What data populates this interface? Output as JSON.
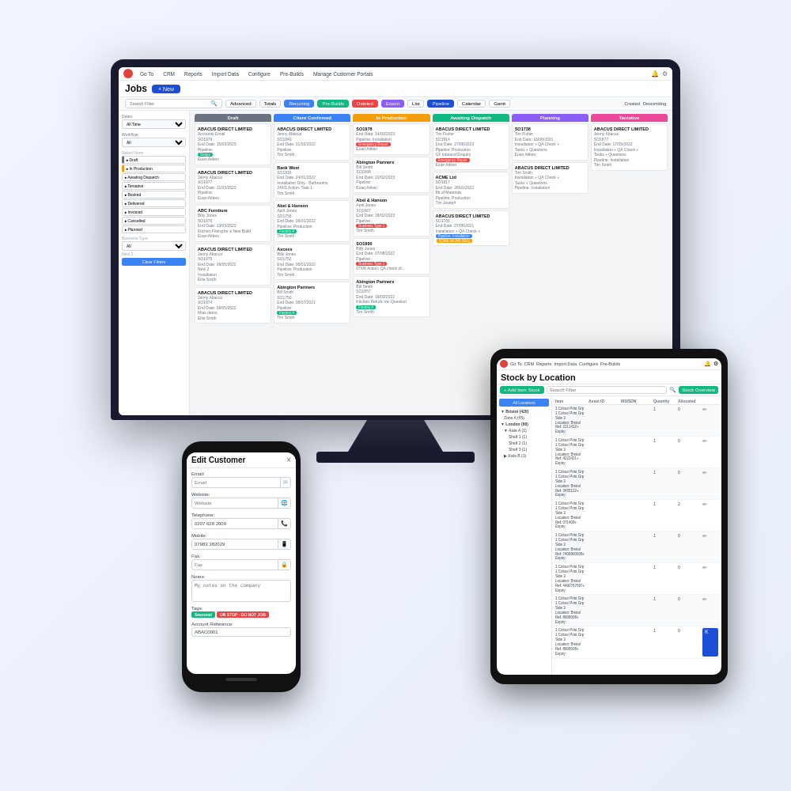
{
  "scene": {
    "background": "#f0f4ff"
  },
  "monitor": {
    "topbar": {
      "logo": "red-circle",
      "nav_items": [
        "Go To",
        "CRM",
        "Reports",
        "Import Data",
        "Configure",
        "Pre-Builds",
        "Manage Customer Portals"
      ],
      "bell_icon": "🔔",
      "gear_icon": "⚙"
    },
    "header": {
      "title": "Jobs",
      "new_button": "+ New"
    },
    "toolbar": {
      "totals_btn": "Totals",
      "recurring_btn": "Recurring",
      "prebuilds_btn": "Pre-Builds",
      "deleted_btn": "Deleted",
      "export_btn": "Export",
      "list_btn": "List",
      "pipeline_btn": "Pipeline",
      "calendar_btn": "Calendar",
      "gantt_btn": "Gantt",
      "search_placeholder": "Search Filter",
      "advanced_btn": "Advanced",
      "created_label": "Created",
      "descending_label": "Descending"
    },
    "sidebar": {
      "dates_label": "Dates:",
      "dates_value": "All Time",
      "workflow_label": "Workflow:",
      "workflow_value": "All",
      "filters": [
        "Draft",
        "In Production",
        "Awaiting Dispatch",
        "Tentative",
        "Booked",
        "Delivered",
        "Invoiced",
        "Cancelled",
        "Planned",
        "Booked"
      ],
      "business_type_label": "Business Type:",
      "business_type_value": "All",
      "clear_btn": "Clear Filters"
    },
    "kanban": {
      "columns": [
        {
          "id": "draft",
          "label": "Draft",
          "color": "#6b7280",
          "cards": [
            {
              "company": "ABACUS DIRECT LIMITED",
              "sub": "Accounts Email",
              "so": "SO1979",
              "end_date": "End Date: 15/03/2023",
              "pipeline": "Pipeline:",
              "badge": "Snaps",
              "badge_color": "green",
              "person": "Euan Aitken"
            },
            {
              "company": "ABACUS DIRECT LIMITED",
              "sub": "Jenny Abacus",
              "so": "SO1977",
              "end_date": "End Date: 11/03/2023",
              "pipeline": "Pipeline:",
              "badge": "",
              "person": "Euan Aitken"
            },
            {
              "company": "ABC Furniture",
              "sub": "Billy Jones",
              "so": "SO1976",
              "end_date": "End Date: 13/03/2023",
              "pipeline": "Kitchen Fitting for a New Build",
              "badge": "",
              "person": "Euan Aitken"
            },
            {
              "company": "ABACUS DIRECT LIMITED",
              "sub": "Jenny Abacus",
              "so": "SO1975",
              "end_date": "End Date: 06/05/2022",
              "pipeline": "New 2",
              "pipeline_sub": "Installation",
              "badge": "",
              "person": "Ellie Smith"
            },
            {
              "company": "ABACUS DIRECT LIMITED",
              "sub": "Jenny Abacus",
              "so": "SO1974",
              "end_date": "End Date: 06/05/2022",
              "pipeline": "Mats demo",
              "badge": "",
              "person": "Ellie Smith"
            }
          ]
        },
        {
          "id": "confirmed",
          "label": "Client Confirmed",
          "color": "#3b82f6",
          "cards": [
            {
              "company": "ABACUS DIRECT LIMITED",
              "sub": "Jenny Abacus",
              "so": "SO1840",
              "end_date": "End Date: 21/02/2022",
              "pipeline": "Pipeline:",
              "badge": "",
              "person": "Tim Smith"
            },
            {
              "company": "Bank West",
              "sub": "End Date: 24/01/2022",
              "so": "SO1816",
              "end_date": "",
              "pipeline": "Installation Only - Bathrooms",
              "badge": "",
              "person": "Tim Smith",
              "extra": "24/01 Action: Task 1"
            },
            {
              "company": "Abel & Hanson",
              "sub": "April Jones",
              "so": "SO1756",
              "end_date": "End Date: 06/01/2022",
              "pipeline": "Pipeline: Production",
              "badge": "Factory A",
              "badge_color": "green",
              "person": "Tim Smith"
            },
            {
              "company": "Axcess",
              "sub": "Billy Jones",
              "so": "SO1752",
              "end_date": "End Date: 06/01/2022",
              "pipeline": "Pipeline: Production",
              "badge": "",
              "person": "Tim Smith"
            },
            {
              "company": "Abington Partners",
              "sub": "Bill Smith",
              "so": "SO1750",
              "end_date": "End Date: 08/07/2021",
              "pipeline": "Pipeline:",
              "badge": "Factory A",
              "badge_color": "green",
              "person": "Tim Smith"
            }
          ]
        },
        {
          "id": "production",
          "label": "In Production",
          "color": "#f59e0b",
          "cards": [
            {
              "company": "SO1978",
              "sub": "End Date: 14/03/2023",
              "so": "",
              "pipeline": "Pipeline: Installation",
              "badge": "Emergency Repair",
              "badge_color": "red",
              "person": "Euan Aitken"
            },
            {
              "company": "Abington Partners",
              "sub": "Bill Smith",
              "so": "SO1968",
              "end_date": "End Date: 22/02/2023",
              "pipeline": "Pipeline:",
              "badge": "",
              "person": "Euan Aitken"
            },
            {
              "company": "Abel & Hanson",
              "sub": "April Jones",
              "so": "SO1967",
              "end_date": "End Date: 16/02/2023",
              "pipeline": "Pipeline:",
              "badge": "Business Type 1",
              "badge_color": "red",
              "person": "Tim Smith"
            },
            {
              "company": "SO1890",
              "sub": "Billy Jones",
              "so": "",
              "end_date": "End Date: 07/08/2022",
              "pipeline": "Pipeline:",
              "badge": "Business Type 1",
              "badge_color": "red",
              "person": "Tim Smith",
              "extra": "07/06 Action: QA check of..."
            },
            {
              "company": "Abington Partners",
              "sub": "Bill Smith",
              "so": "SO1857",
              "end_date": "End Date: 18/03/2022",
              "pipeline": "Pipeline:",
              "badge": "Factory A",
              "badge_color": "green",
              "person": "Tim Smith"
            }
          ]
        },
        {
          "id": "dispatch",
          "label": "Awaiting Dispatch",
          "color": "#10b981",
          "cards": [
            {
              "company": "ABACUS DIRECT LIMITED",
              "sub": "Tim Fisher",
              "so": "SO1914",
              "end_date": "End Date: 27/08/2022",
              "pipeline": "Pipeline: Production",
              "badge": "",
              "extra": "Emergency Repair",
              "extra_color": "red"
            },
            {
              "company": "ACME Ltd",
              "sub": "",
              "so": "SO1817",
              "end_date": "End Date: 26/01/2022",
              "pipeline": "Bit of Materials Pipeline: Production",
              "badge": "",
              "person": "Tim Joseph"
            },
            {
              "company": "ABACUS DIRECT LIMITED",
              "sub": "",
              "so": "SO1766",
              "end_date": "End Date: 07/08/2021",
              "pipeline": "Installation + QA Check +",
              "badge": "Pipeline: Installation",
              "badge_color": "blue",
              "extra": "SOME WORK REQ",
              "extra_color": "orange"
            }
          ]
        },
        {
          "id": "planning",
          "label": "Planning",
          "color": "#8b5cf6",
          "cards": [
            {
              "company": "SO1738",
              "sub": "Tim Fisher",
              "so": "",
              "end_date": "End Date: 16/06/2021",
              "pipeline": "Installation + QA Check +",
              "tasks": "Tasks + Questions",
              "badge": "",
              "person": "Euan Aitken"
            },
            {
              "company": "ABACUS DIRECT LIMITED",
              "sub": "Tim Smith",
              "so": "",
              "end_date": "",
              "pipeline": "Installation + QA Check +",
              "tasks": "Tasks + Questions Pipeline: Installation",
              "badge": "",
              "person": ""
            }
          ]
        },
        {
          "id": "tentative",
          "label": "Tentative",
          "color": "#ec4899",
          "cards": [
            {
              "company": "ABACUS DIRECT LIMITED",
              "sub": "Jenny Abacus",
              "so": "SO1877",
              "end_date": "End Date: 17/05/2022",
              "pipeline": "Installation + QA Check +",
              "tasks": "Tasks + Questions Pipeline: Installation",
              "badge": "",
              "person": "Tim Smith"
            }
          ]
        }
      ]
    }
  },
  "tablet": {
    "topbar": {
      "nav_items": [
        "Go To",
        "CRM",
        "Reports",
        "Import Data",
        "Configure",
        "Pre-Builds"
      ]
    },
    "title": "Stock by Location",
    "toolbar": {
      "add_btn": "+ Add Item Stock",
      "search_placeholder": "Search Filter",
      "overview_btn": "Stock Overview"
    },
    "sidebar": {
      "all_locations_btn": "All Locations",
      "tree": [
        {
          "label": "Bristol (420)",
          "level": 0,
          "bold": true
        },
        {
          "label": "Zone A (45)",
          "level": 1
        },
        {
          "label": "London (66)",
          "level": 0,
          "bold": true
        },
        {
          "label": "Aisle A (1)",
          "level": 1
        },
        {
          "label": "Shelf 1 (1)",
          "level": 2
        },
        {
          "label": "Shelf 2 (1)",
          "level": 2
        },
        {
          "label": "Shelf 3 (1)",
          "level": 2
        },
        {
          "label": "Aisle B (1)",
          "level": 1
        }
      ]
    },
    "table": {
      "headers": [
        "Item",
        "Asset ID",
        "MSISDN",
        "Quantity",
        "Allocated",
        ""
      ],
      "rows": [
        {
          "item": "1 Colour Print Grp\n1 Colour Print Grp Side 3\nLocation: Bristol\nRef: 2211412+\nExpiry:",
          "asset_id": "",
          "msisdn": "",
          "qty": "1",
          "alloc": "0"
        },
        {
          "item": "1 Colour Print Grp\n1 Colour Print Grp Side 3\nLocation: Bristol\nRef: 4222421+\nExpiry:",
          "asset_id": "",
          "msisdn": "",
          "qty": "1",
          "alloc": "0"
        },
        {
          "item": "1 Colour Print Grp\n1 Colour Print Grp Side 3\nLocation: Bristol\nRef: 3455122+\nExpiry:",
          "asset_id": "",
          "msisdn": "",
          "qty": "1",
          "alloc": "0"
        },
        {
          "item": "1 Colour Print Grp\n1 Colour Print Grp Side 3\nLocation: Bristol\nRef: 071409+\nExpiry:",
          "asset_id": "",
          "msisdn": "",
          "qty": "1",
          "alloc": "2"
        },
        {
          "item": "1 Colour Print Grp\n1 Colour Print Grp Side 3\nLocation: Bristol\nRef: 7406900008+\nExpiry:",
          "asset_id": "",
          "msisdn": "",
          "qty": "1",
          "alloc": "0"
        },
        {
          "item": "1 Colour Print Grp\n1 Colour Print Grp Side 3\nLocation: Bristol\nRef: 4490767697+\nExpiry:",
          "asset_id": "",
          "msisdn": "",
          "qty": "1",
          "alloc": "0"
        },
        {
          "item": "1 Colour Print Grp\n1 Colour Print Grp Side 3\nLocation: Bristol\nRef: 8908008+\nExpiry:",
          "asset_id": "",
          "msisdn": "",
          "qty": "1",
          "alloc": "0"
        },
        {
          "item": "1 Colour Print Grp\n1 Colour Print Grp Side 3\nLocation: Bristol\nRef: 8908008+\nExpiry:",
          "asset_id": "",
          "msisdn": "",
          "qty": "1",
          "alloc": "0"
        }
      ]
    }
  },
  "phone": {
    "title": "Edit Customer",
    "close_icon": "×",
    "fields": [
      {
        "label": "Email:",
        "placeholder": "Email",
        "value": "",
        "icon": "✉"
      },
      {
        "label": "Website:",
        "placeholder": "Website",
        "value": "",
        "icon": "🌐"
      },
      {
        "label": "Telephone:",
        "placeholder": "",
        "value": "0207 628 2009",
        "icon": "📞"
      },
      {
        "label": "Mobile:",
        "placeholder": "",
        "value": "07983 382029",
        "icon": "📱"
      },
      {
        "label": "Fax:",
        "placeholder": "Fax",
        "value": "",
        "icon": "🔒"
      },
      {
        "label": "Notes:",
        "placeholder": "My notes on the company",
        "value": "",
        "icon": ""
      }
    ],
    "tags_label": "Tags:",
    "tags": [
      {
        "label": "Seasonal",
        "color": "#10b981"
      },
      {
        "label": "ON STOP - DO NOT JOB",
        "color": "#ef4444"
      }
    ],
    "account_ref_label": "Account Reference:",
    "account_ref_value": "ABAC0001"
  }
}
